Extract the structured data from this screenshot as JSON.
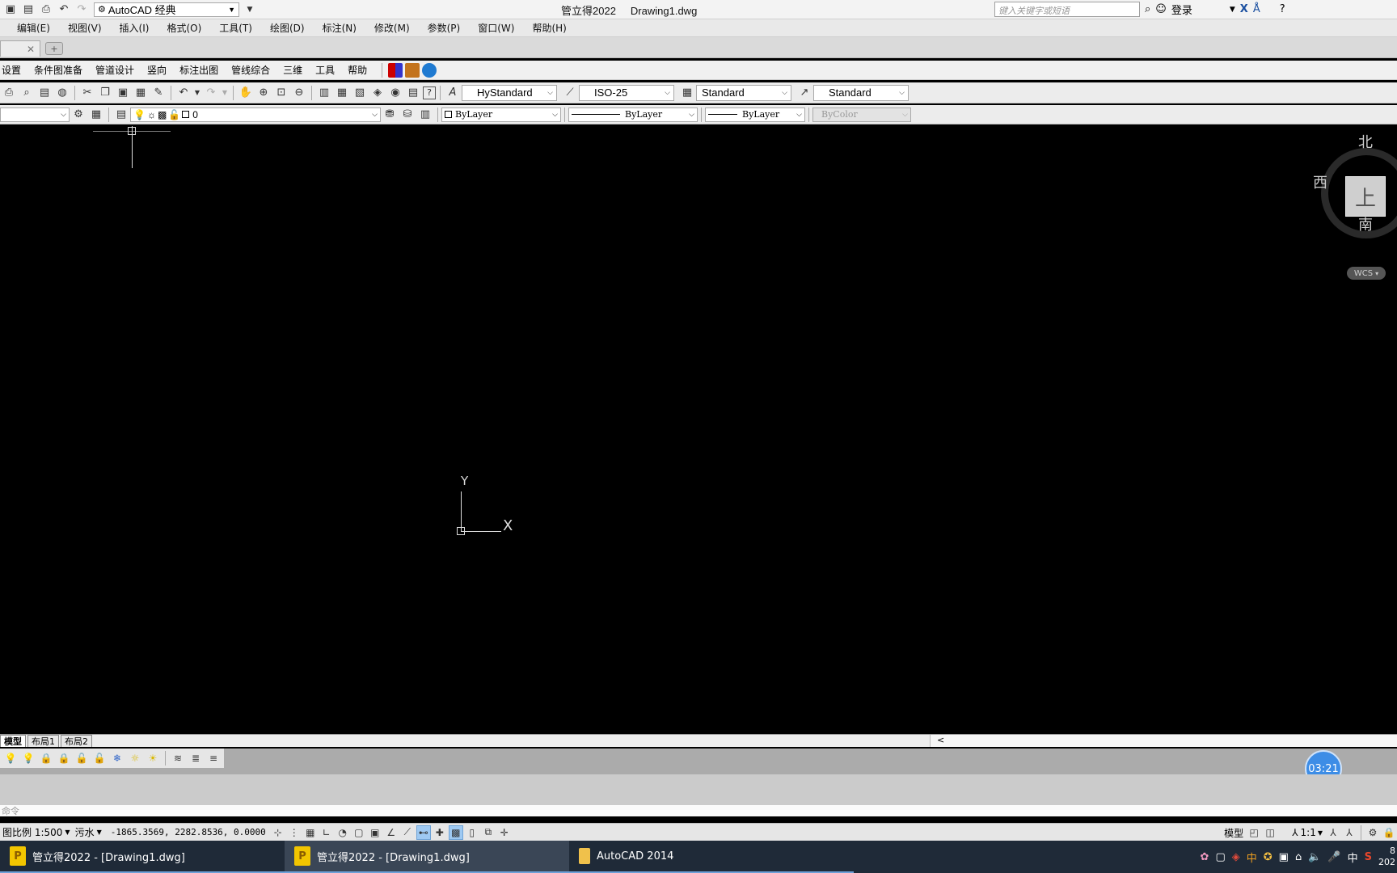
{
  "title_bar": {
    "workspace": "AutoCAD 经典",
    "app_name": "管立得2022",
    "file_name": "Drawing1.dwg",
    "search_placeholder": "键入关键字或短语",
    "login_label": "登录"
  },
  "menu": [
    "编辑(E)",
    "视图(V)",
    "插入(I)",
    "格式(O)",
    "工具(T)",
    "绘图(D)",
    "标注(N)",
    "修改(M)",
    "参数(P)",
    "窗口(W)",
    "帮助(H)"
  ],
  "plugin_menu": [
    "设置",
    "条件图准备",
    "管道设计",
    "竖向",
    "标注出图",
    "管线综合",
    "三维",
    "工具",
    "帮助"
  ],
  "styles": {
    "text_style": "HyStandard",
    "dim_style": "ISO-25",
    "table_style": "Standard",
    "multileader_style": "Standard"
  },
  "layer_bar": {
    "current_layer": "0",
    "color": "ByLayer",
    "linetype": "ByLayer",
    "lineweight": "ByLayer",
    "plotstyle": "ByColor"
  },
  "viewcube": {
    "north": "北",
    "south": "南",
    "west": "西",
    "face": "上",
    "wcs": "WCS"
  },
  "ucs": {
    "x_label": "X",
    "y_label": "Y"
  },
  "layout_tabs": [
    "模型",
    "布局1",
    "布局2"
  ],
  "timer": "03:21",
  "command_prompt": "命令",
  "status_bar": {
    "scale_label": "图比例 1:500",
    "pipe_type": "污水",
    "coordinates": "-1865.3569, 2282.8536, 0.0000",
    "model_label": "模型",
    "annotation_scale": "1:1"
  },
  "taskbar": {
    "items": [
      {
        "label": "管立得2022 - [Drawing1.dwg]"
      },
      {
        "label": "管立得2022 - [Drawing1.dwg]"
      },
      {
        "label": "AutoCAD 2014"
      }
    ],
    "ime": "中",
    "clock_time": "8",
    "clock_date": "202"
  },
  "colors": {
    "canvas": "#000000",
    "timer": "#3d8de6",
    "taskbar": "#1f2a38"
  }
}
